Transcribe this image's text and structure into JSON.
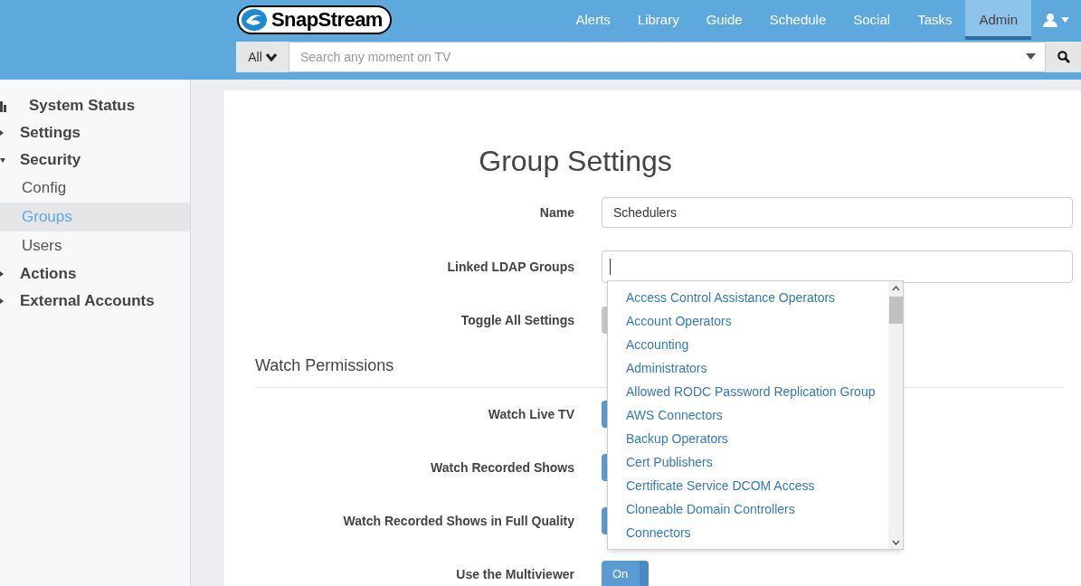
{
  "logo": {
    "text": "SnapStream"
  },
  "nav": [
    {
      "label": "Alerts",
      "selected": false
    },
    {
      "label": "Library",
      "selected": false
    },
    {
      "label": "Guide",
      "selected": false
    },
    {
      "label": "Schedule",
      "selected": false
    },
    {
      "label": "Social",
      "selected": false
    },
    {
      "label": "Tasks",
      "selected": false
    },
    {
      "label": "Admin",
      "selected": true
    }
  ],
  "search": {
    "scope": "All",
    "placeholder": "Search any moment on TV"
  },
  "sidebar": {
    "items": [
      {
        "label": "System Status",
        "kind": "chart"
      },
      {
        "label": "Settings",
        "kind": "group",
        "expanded": false
      },
      {
        "label": "Security",
        "kind": "group",
        "expanded": true,
        "children": [
          {
            "label": "Config",
            "selected": false
          },
          {
            "label": "Groups",
            "selected": true
          },
          {
            "label": "Users",
            "selected": false
          }
        ]
      },
      {
        "label": "Actions",
        "kind": "group",
        "expanded": false
      },
      {
        "label": "External Accounts",
        "kind": "group",
        "expanded": false
      }
    ]
  },
  "form": {
    "title": "Group Settings",
    "name": {
      "label": "Name",
      "value": "Schedulers"
    },
    "ldap": {
      "label": "Linked LDAP Groups"
    },
    "toggle_all": {
      "label": "Toggle All Settings",
      "on": false
    },
    "section": "Watch Permissions",
    "permissions": [
      {
        "label": "Watch Live TV",
        "on": true
      },
      {
        "label": "Watch Recorded Shows",
        "on": true
      },
      {
        "label": "Watch Recorded Shows in Full Quality",
        "on": true
      },
      {
        "label": "Use the Multiviewer",
        "on": true,
        "state_text": "On"
      }
    ]
  },
  "ldap_dropdown": {
    "options": [
      "Access Control Assistance Operators",
      "Account Operators",
      "Accounting",
      "Administrators",
      "Allowed RODC Password Replication Group",
      "AWS Connectors",
      "Backup Operators",
      "Cert Publishers",
      "Certificate Service DCOM Access",
      "Cloneable Domain Controllers",
      "Connectors"
    ]
  }
}
